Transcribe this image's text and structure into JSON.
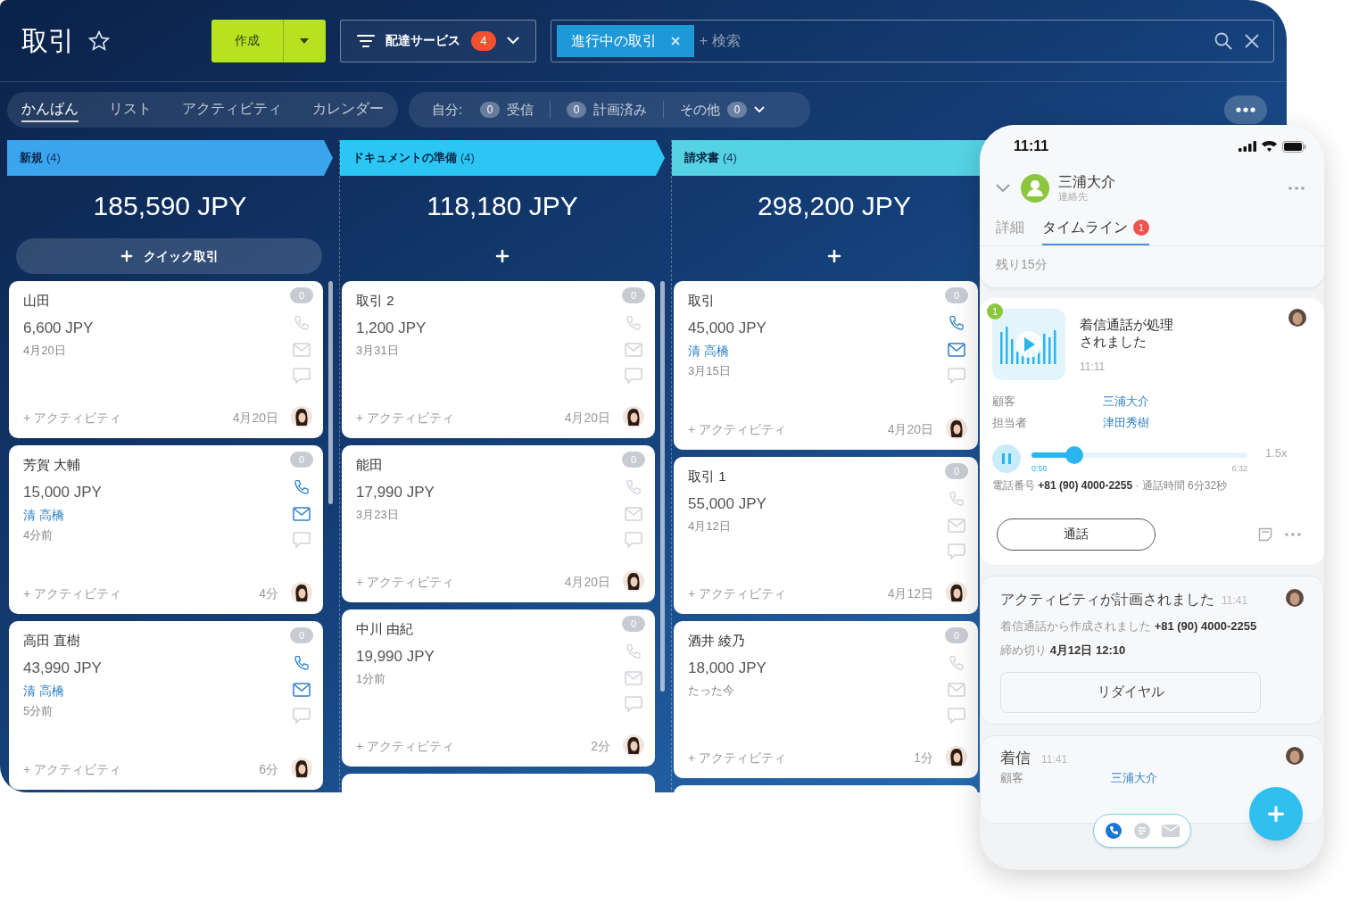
{
  "header": {
    "title": "取引",
    "create_button": "作成",
    "filter_button": {
      "label": "配達サービス",
      "badge": "4"
    },
    "search": {
      "chip": "進行中の取引",
      "placeholder": "+ 検索"
    }
  },
  "view_tabs": [
    {
      "label": "かんばん",
      "selected": true
    },
    {
      "label": "リスト",
      "selected": false
    },
    {
      "label": "アクティビティ",
      "selected": false
    },
    {
      "label": "カレンダー",
      "selected": false
    }
  ],
  "my_filters": {
    "label": "自分:",
    "items": [
      {
        "count": "0",
        "label": "受信",
        "dropdown": false
      },
      {
        "count": "0",
        "label": "計画済み",
        "dropdown": false
      },
      {
        "label": "その他",
        "count": "0",
        "dropdown": true
      }
    ]
  },
  "columns": [
    {
      "name": "新規",
      "count": "(4)",
      "color": "#3ba4ee",
      "total": "185,590 JPY",
      "quick_add": "クイック取引",
      "cards": [
        {
          "kind": "deal",
          "title": "山田",
          "amount": "6,600 JPY",
          "date": "4月20日",
          "activity": "+ アクティビティ",
          "due": "4月20日",
          "badge": "0",
          "phone_active": false,
          "mail_active": false
        },
        {
          "kind": "deal",
          "title": "芳賀 大輔",
          "amount": "15,000 JPY",
          "contact": "清 高橋",
          "date": "4分前",
          "activity": "+ アクティビティ",
          "due": "4分",
          "badge": "0",
          "phone_active": true,
          "mail_active": true
        },
        {
          "kind": "deal",
          "title": "高田 直樹",
          "amount": "43,990 JPY",
          "contact": "清 高橋",
          "date": "5分前",
          "activity": "+ アクティビティ",
          "due": "6分",
          "badge": "0",
          "phone_active": true,
          "mail_active": true
        }
      ]
    },
    {
      "name": "ドキュメントの準備",
      "count": "(4)",
      "color": "#2cc6f4",
      "total": "118,180 JPY",
      "cards": [
        {
          "kind": "deal",
          "title": "取引 2",
          "amount": "1,200 JPY",
          "date": "3月31日",
          "activity": "+ アクティビティ",
          "due": "4月20日",
          "badge": "0",
          "phone_active": false,
          "mail_active": false
        },
        {
          "kind": "deal",
          "title": "能田",
          "amount": "17,990 JPY",
          "date": "3月23日",
          "activity": "+ アクティビティ",
          "due": "4月20日",
          "badge": "0",
          "phone_active": false,
          "mail_active": false
        },
        {
          "kind": "deal",
          "title": "中川 由紀",
          "amount": "19,990 JPY",
          "date": "1分前",
          "activity": "+ アクティビティ",
          "due": "2分",
          "badge": "0",
          "phone_active": false,
          "mail_active": false
        },
        {
          "kind": "stub"
        }
      ]
    },
    {
      "name": "請求書",
      "count": "(4)",
      "color": "#55d2e3",
      "total": "298,200 JPY",
      "cards": [
        {
          "kind": "deal",
          "title": "取引",
          "amount": "45,000 JPY",
          "contact": "清 高橋",
          "date": "3月15日",
          "activity": "+ アクティビティ",
          "due": "4月20日",
          "badge": "0",
          "phone_active": true,
          "mail_active": true
        },
        {
          "kind": "deal",
          "title": "取引 1",
          "amount": "55,000 JPY",
          "date": "4月12日",
          "activity": "+ アクティビティ",
          "due": "4月12日",
          "badge": "0",
          "phone_active": false,
          "mail_active": false
        },
        {
          "kind": "deal",
          "title": "酒井 綾乃",
          "amount": "18,000 JPY",
          "date": "たった今",
          "activity": "+ アクティビティ",
          "due": "1分",
          "badge": "0",
          "phone_active": false,
          "mail_active": false
        },
        {
          "kind": "stub"
        }
      ]
    }
  ],
  "phone": {
    "time": "11:11",
    "contact": {
      "name": "三浦大介",
      "subtitle": "連絡先"
    },
    "tabs": [
      {
        "label": "詳細",
        "selected": false
      },
      {
        "label": "タイムライン",
        "selected": true,
        "badge": "1"
      }
    ],
    "remaining": "残り15分",
    "call": {
      "badge": "1",
      "title": "着信通話が処理されました",
      "time": "11:11",
      "fields": [
        {
          "label": "顧客",
          "value": "三浦大介"
        },
        {
          "label": "担当者",
          "value": "津田秀樹"
        }
      ],
      "player": {
        "playing": true,
        "level": 0.2,
        "elapsed": "0:56",
        "duration": "6:32",
        "speed": "1.5x"
      },
      "info": "電話番号 **+81 (90) 4000-2255** · 通話時間 6分32秒",
      "button": "通話"
    },
    "activity": {
      "title": "アクティビティが計画されました",
      "time": "11:41",
      "lines": [
        "着信通話から作成されました **+81 (90) 4000-2255**",
        "締め切り **4月12日 12:10**"
      ],
      "button": "リダイヤル"
    },
    "incoming": {
      "title": "着信",
      "time": "11:41",
      "field": {
        "label": "顧客",
        "value": "三浦大介"
      }
    },
    "channels": [
      {
        "kind": "phone",
        "selected": true
      },
      {
        "kind": "chat",
        "selected": false
      },
      {
        "kind": "mail",
        "selected": false
      }
    ]
  }
}
